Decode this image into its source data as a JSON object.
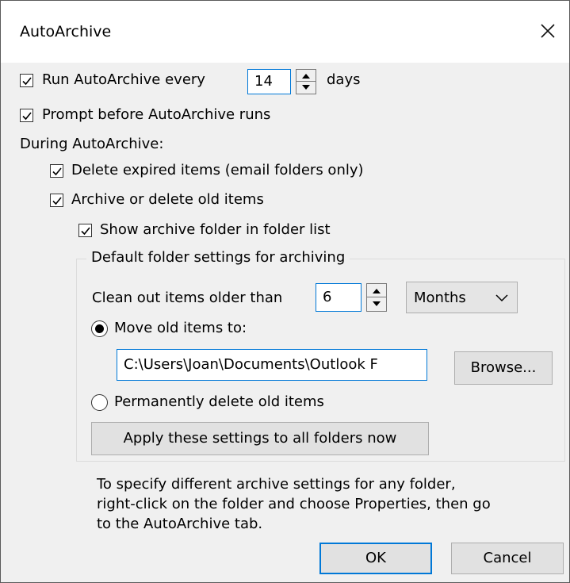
{
  "window": {
    "title": "AutoArchive"
  },
  "run_every": {
    "label": "Run AutoArchive every",
    "value": "14",
    "unit": "days",
    "checked": true
  },
  "prompt": {
    "label": "Prompt before AutoArchive runs",
    "checked": true
  },
  "during_label": "During AutoArchive:",
  "delete_expired": {
    "label": "Delete expired items (email folders only)",
    "checked": true
  },
  "archive_old": {
    "label": "Archive or delete old items",
    "checked": true
  },
  "show_folder": {
    "label": "Show archive folder in folder list",
    "checked": true
  },
  "group": {
    "title": "Default folder settings for archiving",
    "clean_label": "Clean out items older than",
    "clean_value": "6",
    "clean_unit": "Months",
    "move_label": "Move old items to:",
    "move_selected": true,
    "path": "C:\\Users\\Joan\\Documents\\Outlook F",
    "browse_label": "Browse...",
    "delete_label": "Permanently delete old items",
    "delete_selected": false,
    "apply_label": "Apply these settings to all folders now"
  },
  "info_lines": [
    "To specify different archive settings for any folder,",
    "right-click on the folder and choose Properties, then go",
    "to the AutoArchive tab."
  ],
  "buttons": {
    "ok": "OK",
    "cancel": "Cancel"
  },
  "colors": {
    "focus_border": "#0078d7",
    "dialog_bg": "#f0f0f0",
    "titlebar_bg": "#ffffff"
  },
  "icons": {
    "close": "close-icon",
    "check": "checkmark-icon",
    "spin_up": "arrow-up-icon",
    "spin_down": "arrow-down-icon",
    "dropdown": "chevron-down-icon"
  }
}
